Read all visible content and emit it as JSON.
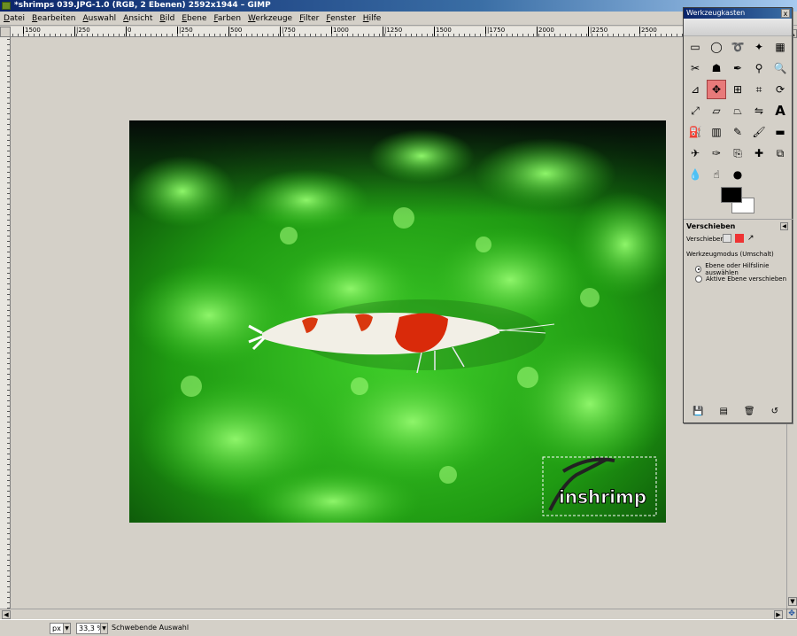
{
  "window": {
    "title": "*shrimps 039.JPG-1.0 (RGB, 2 Ebenen) 2592x1944 – GIMP"
  },
  "menu": [
    "Datei",
    "Bearbeiten",
    "Auswahl",
    "Ansicht",
    "Bild",
    "Ebene",
    "Farben",
    "Werkzeuge",
    "Filter",
    "Fenster",
    "Hilfe"
  ],
  "ruler": {
    "h_labels": [
      "1500",
      "|250",
      "0",
      "|250",
      "500",
      "|750",
      "1000",
      "|1250",
      "1500",
      "|1750",
      "2000",
      "|2250",
      "2500"
    ]
  },
  "canvas": {
    "watermark_text": "inshrimp"
  },
  "status": {
    "unit": "px",
    "zoom": "33,3 %",
    "message": "Schwebende Auswahl"
  },
  "toolbox": {
    "title": "Werkzeugkasten",
    "close": "x",
    "tool_icons": [
      "rect-select-icon",
      "ellipse-select-icon",
      "lasso-icon",
      "fuzzy-select-icon",
      "color-select-icon",
      "scissors-icon",
      "foreground-select-icon",
      "paths-icon",
      "color-picker-icon",
      "zoom-icon",
      "measure-icon",
      "move-icon",
      "align-icon",
      "crop-icon",
      "rotate-icon",
      "scale-icon",
      "shear-icon",
      "perspective-icon",
      "flip-icon",
      "text-icon",
      "bucket-fill-icon",
      "blend-icon",
      "pencil-icon",
      "paintbrush-icon",
      "eraser-icon",
      "airbrush-icon",
      "ink-icon",
      "clone-icon",
      "heal-icon",
      "perspective-clone-icon",
      "blur-icon",
      "smudge-icon",
      "dodge-burn-icon"
    ],
    "active_tool": "move-icon",
    "fg_color": "#000000",
    "bg_color": "#ffffff",
    "options": {
      "title": "Verschieben",
      "move_label": "Verschieben:",
      "mode_label": "Werkzeugmodus (Umschalt)",
      "mode_options": [
        "Ebene oder Hilfslinie auswählen",
        "Aktive Ebene verschieben"
      ],
      "selected_mode": 0
    },
    "footer_icons": [
      "save-options-icon",
      "restore-options-icon",
      "delete-options-icon",
      "reset-options-icon"
    ]
  }
}
